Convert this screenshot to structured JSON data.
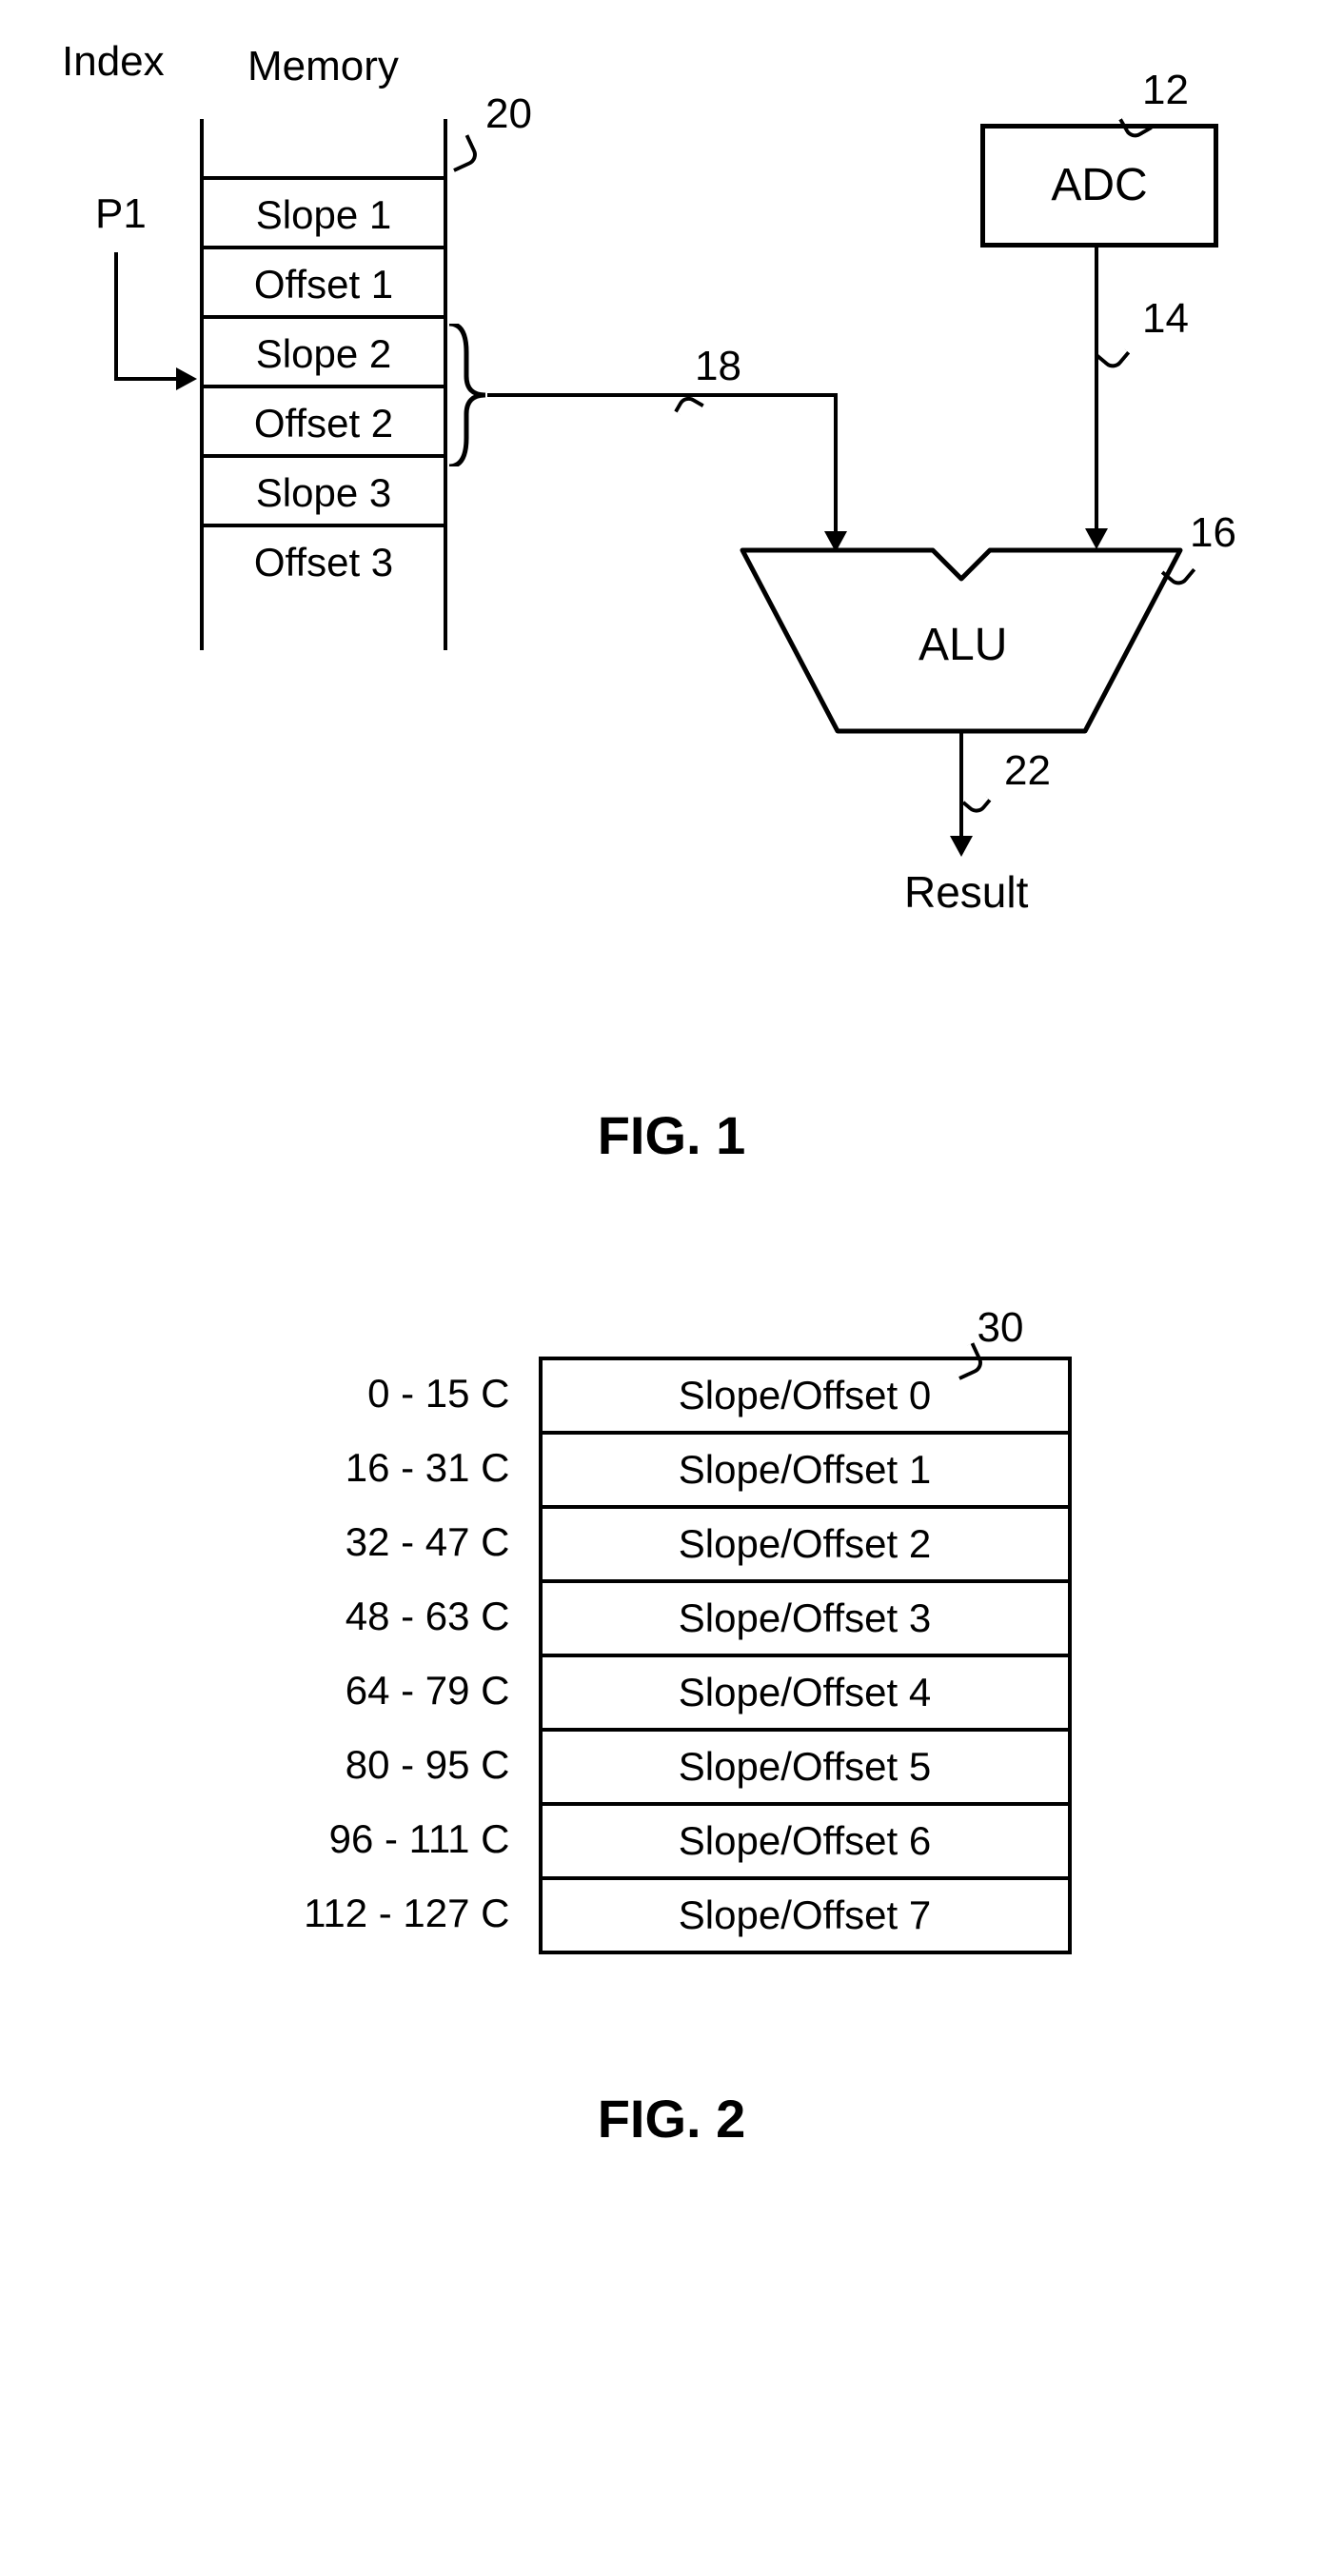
{
  "fig1": {
    "index_label": "Index",
    "memory_label": "Memory",
    "pointer_label": "P1",
    "memory_cells": [
      "Slope 1",
      "Offset 1",
      "Slope 2",
      "Offset 2",
      "Slope 3",
      "Offset 3"
    ],
    "ref_memory": "20",
    "ref_mem_to_alu": "18",
    "adc_label": "ADC",
    "ref_adc": "12",
    "ref_adc_to_alu": "14",
    "alu_label": "ALU",
    "ref_alu": "16",
    "ref_alu_out": "22",
    "result_label": "Result",
    "caption": "FIG. 1"
  },
  "fig2": {
    "ref_table": "30",
    "rows": [
      {
        "range": "0 - 15 C",
        "entry": "Slope/Offset 0"
      },
      {
        "range": "16 - 31 C",
        "entry": "Slope/Offset 1"
      },
      {
        "range": "32 - 47 C",
        "entry": "Slope/Offset 2"
      },
      {
        "range": "48 - 63 C",
        "entry": "Slope/Offset 3"
      },
      {
        "range": "64 - 79 C",
        "entry": "Slope/Offset 4"
      },
      {
        "range": "80 - 95 C",
        "entry": "Slope/Offset 5"
      },
      {
        "range": "96 - 111 C",
        "entry": "Slope/Offset 6"
      },
      {
        "range": "112 - 127 C",
        "entry": "Slope/Offset 7"
      }
    ],
    "caption": "FIG. 2"
  }
}
